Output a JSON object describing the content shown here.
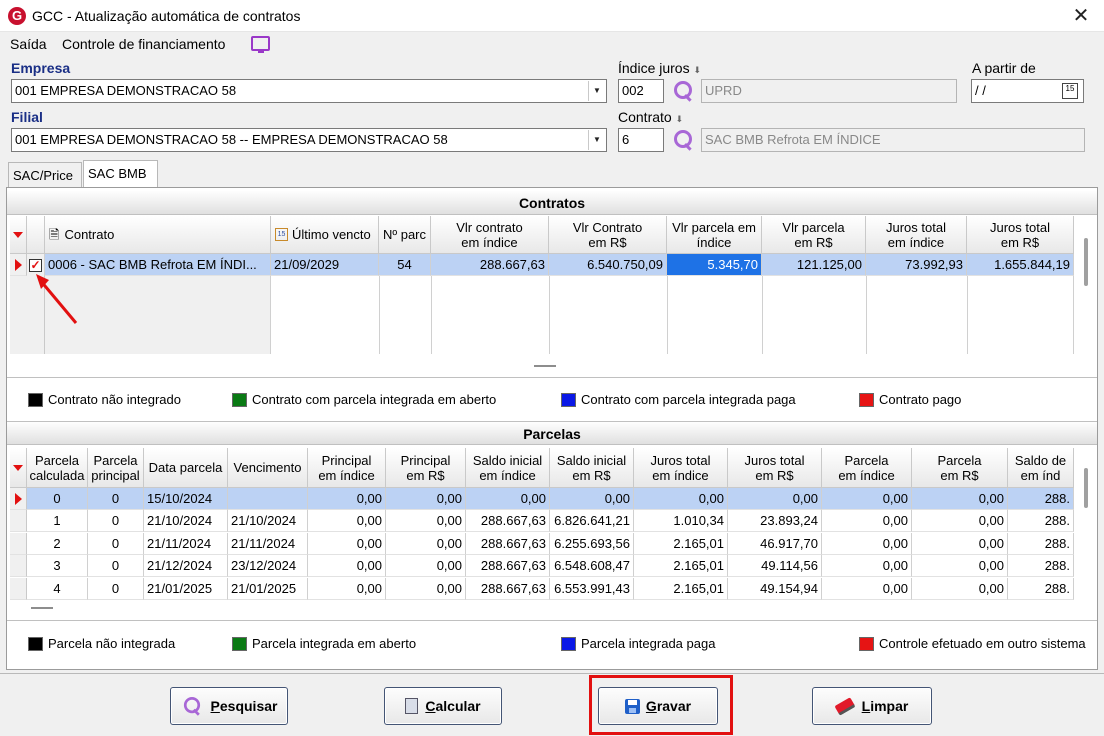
{
  "window": {
    "title": "GCC - Atualização automática de contratos",
    "logo": "G",
    "close": "✕"
  },
  "menu": {
    "items": [
      "Saída",
      "Controle de financiamento"
    ]
  },
  "form": {
    "empresa_label": "Empresa",
    "empresa_value": "001 EMPRESA DEMONSTRACAO 58",
    "filial_label": "Filial",
    "filial_value": "001 EMPRESA DEMONSTRACAO 58 -- EMPRESA DEMONSTRACAO 58",
    "indice_label": "Índice juros",
    "indice_code": "002",
    "indice_desc": "UPRD",
    "contrato_label": "Contrato",
    "contrato_code": "6",
    "contrato_desc": "SAC BMB Refrota EM ÍNDICE",
    "apartir_label": "A partir de",
    "apartir_value": " / /",
    "cal_icon": "15"
  },
  "tabs": [
    {
      "label": "SAC/Price",
      "active": false
    },
    {
      "label": "SAC BMB",
      "active": true
    }
  ],
  "contratos": {
    "title": "Contratos",
    "columns": [
      "Contrato",
      "Último vencto",
      "Nº parc",
      "Vlr contrato\nem índice",
      "Vlr Contrato\nem R$",
      "Vlr parcela em\níndice",
      "Vlr parcela\nem R$",
      "Juros total\nem índice",
      "Juros total\nem R$"
    ],
    "rows": [
      {
        "contrato": "0006 - SAC BMB Refrota EM ÍNDI...",
        "ultimo": "21/09/2029",
        "nparc": "54",
        "vlr_ind": "288.667,63",
        "vlr_rs": "6.540.750,09",
        "parc_ind": "5.345,70",
        "parc_rs": "121.125,00",
        "juros_ind": "73.992,93",
        "juros_rs": "1.655.844,19",
        "checked": true
      }
    ],
    "legend": [
      "Contrato não integrado",
      "Contrato com parcela integrada em aberto",
      "Contrato com parcela integrada paga",
      "Contrato pago"
    ]
  },
  "parcelas": {
    "title": "Parcelas",
    "columns": [
      "Parcela\ncalculada",
      "Parcela\nprincipal",
      "Data parcela",
      "Vencimento",
      "Principal\nem índice",
      "Principal\nem R$",
      "Saldo inicial\nem índice",
      "Saldo inicial\nem R$",
      "Juros total\nem índice",
      "Juros total\nem R$",
      "Parcela\nem índice",
      "Parcela\nem R$",
      "Saldo de\nem índ"
    ],
    "rows": [
      [
        "0",
        "0",
        "15/10/2024",
        "",
        "0,00",
        "0,00",
        "0,00",
        "0,00",
        "0,00",
        "0,00",
        "0,00",
        "0,00",
        "288."
      ],
      [
        "1",
        "0",
        "21/10/2024",
        "21/10/2024",
        "0,00",
        "0,00",
        "288.667,63",
        "6.826.641,21",
        "1.010,34",
        "23.893,24",
        "0,00",
        "0,00",
        "288."
      ],
      [
        "2",
        "0",
        "21/11/2024",
        "21/11/2024",
        "0,00",
        "0,00",
        "288.667,63",
        "6.255.693,56",
        "2.165,01",
        "46.917,70",
        "0,00",
        "0,00",
        "288."
      ],
      [
        "3",
        "0",
        "21/12/2024",
        "23/12/2024",
        "0,00",
        "0,00",
        "288.667,63",
        "6.548.608,47",
        "2.165,01",
        "49.114,56",
        "0,00",
        "0,00",
        "288."
      ],
      [
        "4",
        "0",
        "21/01/2025",
        "21/01/2025",
        "0,00",
        "0,00",
        "288.667,63",
        "6.553.991,43",
        "2.165,01",
        "49.154,94",
        "0,00",
        "0,00",
        "288."
      ]
    ],
    "legend": [
      "Parcela não integrada",
      "Parcela integrada em aberto",
      "Parcela integrada paga",
      "Controle efetuado em outro sistema"
    ]
  },
  "legend_colors": [
    "#000000",
    "#0a7a14",
    "#0a18e6",
    "#e61414"
  ],
  "buttons": [
    {
      "label": "Pesquisar",
      "key": "P",
      "rest": "esquisar",
      "icon": "search-icon"
    },
    {
      "label": "Calcular",
      "key": "C",
      "rest": "alcular",
      "icon": "calculator-icon"
    },
    {
      "label": "Gravar",
      "key": "G",
      "rest": "ravar",
      "icon": "save-icon"
    },
    {
      "label": "Limpar",
      "key": "L",
      "rest": "impar",
      "icon": "eraser-icon"
    }
  ],
  "highlight_color": "#e21010"
}
